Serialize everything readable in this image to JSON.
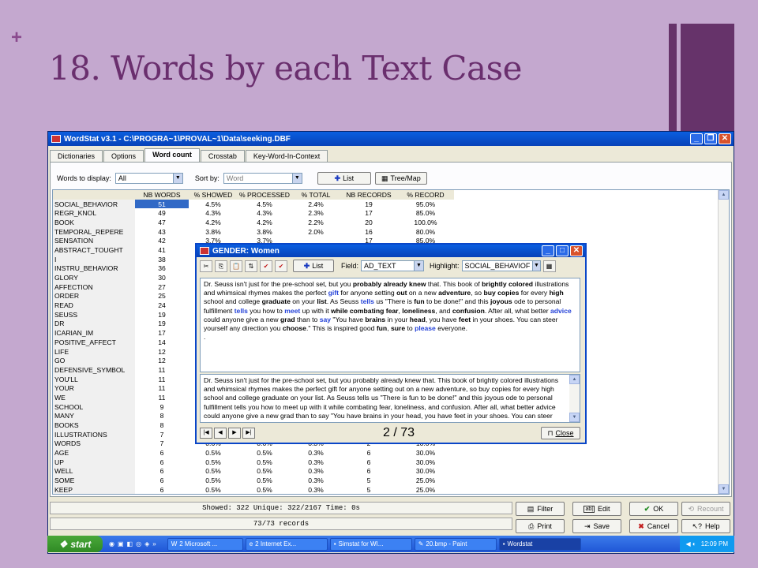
{
  "slide": {
    "plus": "+",
    "title": "18. Words by each Text Case"
  },
  "window": {
    "title": "WordStat v3.1 - C:\\PROGRA~1\\PROVAL~1\\Data\\seeking.DBF",
    "tabs": [
      "Dictionaries",
      "Options",
      "Word count",
      "Crosstab",
      "Key-Word-In-Context"
    ],
    "controls": {
      "words_label": "Words to display:",
      "words_value": "All",
      "sort_label": "Sort by:",
      "sort_value": "Word",
      "list_button": "List",
      "treemap_button": "Tree/Map"
    },
    "table": {
      "headers": [
        "",
        "NB WORDS",
        "% SHOWED",
        "% PROCESSED",
        "% TOTAL",
        "NB RECORDS",
        "% RECORD"
      ],
      "rows": [
        [
          "SOCIAL_BEHAVIOR",
          "51",
          "4.5%",
          "4.5%",
          "2.4%",
          "19",
          "95.0%"
        ],
        [
          "REGR_KNOL",
          "49",
          "4.3%",
          "4.3%",
          "2.3%",
          "17",
          "85.0%"
        ],
        [
          "BOOK",
          "47",
          "4.2%",
          "4.2%",
          "2.2%",
          "20",
          "100.0%"
        ],
        [
          "TEMPORAL_REPERE",
          "43",
          "3.8%",
          "3.8%",
          "2.0%",
          "16",
          "80.0%"
        ],
        [
          "SENSATION",
          "42",
          "3.7%",
          "3.7%",
          "",
          "17",
          "85.0%"
        ],
        [
          "ABSTRACT_TOUGHT",
          "41",
          "",
          "",
          "",
          "",
          ""
        ],
        [
          "I",
          "38",
          "",
          "",
          "",
          "",
          ""
        ],
        [
          "INSTRU_BEHAVIOR",
          "36",
          "",
          "",
          "",
          "",
          ""
        ],
        [
          "GLORY",
          "30",
          "",
          "",
          "",
          "",
          ""
        ],
        [
          "AFFECTION",
          "27",
          "",
          "",
          "",
          "",
          ""
        ],
        [
          "ORDER",
          "25",
          "",
          "",
          "",
          "",
          ""
        ],
        [
          "READ",
          "24",
          "",
          "",
          "",
          "",
          ""
        ],
        [
          "SEUSS",
          "19",
          "",
          "",
          "",
          "",
          ""
        ],
        [
          "DR",
          "19",
          "",
          "",
          "",
          "",
          ""
        ],
        [
          "ICARIAN_IM",
          "17",
          "",
          "",
          "",
          "",
          ""
        ],
        [
          "POSITIVE_AFFECT",
          "14",
          "",
          "",
          "",
          "",
          ""
        ],
        [
          "LIFE",
          "12",
          "",
          "",
          "",
          "",
          ""
        ],
        [
          "GO",
          "12",
          "",
          "",
          "",
          "",
          ""
        ],
        [
          "DEFENSIVE_SYMBOL",
          "11",
          "",
          "",
          "",
          "",
          ""
        ],
        [
          "YOU'LL",
          "11",
          "",
          "",
          "",
          "",
          ""
        ],
        [
          "YOUR",
          "11",
          "",
          "",
          "",
          "",
          ""
        ],
        [
          "WE",
          "11",
          "",
          "",
          "",
          "",
          ""
        ],
        [
          "SCHOOL",
          "9",
          "",
          "",
          "",
          "",
          ""
        ],
        [
          "MANY",
          "8",
          "",
          "",
          "",
          "",
          ""
        ],
        [
          "BOOKS",
          "8",
          "",
          "",
          "",
          "",
          ""
        ],
        [
          "ILLUSTRATIONS",
          "7",
          "",
          "",
          "",
          "",
          ""
        ],
        [
          "WORDS",
          "7",
          "0.6%",
          "0.6%",
          "0.3%",
          "2",
          "10.0%"
        ],
        [
          "AGE",
          "6",
          "0.5%",
          "0.5%",
          "0.3%",
          "6",
          "30.0%"
        ],
        [
          "UP",
          "6",
          "0.5%",
          "0.5%",
          "0.3%",
          "6",
          "30.0%"
        ],
        [
          "WELL",
          "6",
          "0.5%",
          "0.5%",
          "0.3%",
          "6",
          "30.0%"
        ],
        [
          "SOME",
          "6",
          "0.5%",
          "0.5%",
          "0.3%",
          "5",
          "25.0%"
        ],
        [
          "KEEP",
          "6",
          "0.5%",
          "0.5%",
          "0.3%",
          "5",
          "25.0%"
        ]
      ]
    },
    "status": {
      "line1": "Showed: 322  Unique: 322/2167  Time: 0s",
      "line2": "73/73 records"
    },
    "buttons": {
      "filter": "Filter",
      "edit": "Edit",
      "ok": "OK",
      "recount": "Recount",
      "print": "Print",
      "save": "Save",
      "cancel": "Cancel",
      "help": "Help"
    }
  },
  "dialog": {
    "title": "GENDER: Women",
    "list_button": "List",
    "field_label": "Field:",
    "field_value": "AD_TEXT",
    "highlight_label": "Highlight:",
    "highlight_value": "SOCIAL_BEHAVIOF",
    "plain_text": "Dr. Seuss isn't just for the pre-school set, but you probably already knew that. This book of brightly colored illustrations and whimsical rhymes makes the perfect gift for anyone setting out on a new adventure, so buy copies for every high school and college graduate on your list. As Seuss tells us \"There is fun to be done!\" and this joyous ode to personal fulfillment tells you how to meet up with it while combating fear, loneliness, and confusion. After all, what better advice could anyone give a new grad than to say \"You have brains in your head, you have feet in your shoes. You can steer yourself",
    "record": "2 / 73",
    "close": "Close"
  },
  "taskbar": {
    "start": "start",
    "tasks": [
      "2 Microsoft ...",
      "2 Internet Ex...",
      "Simstat for WI...",
      "20.bmp - Paint",
      "Wordstat"
    ],
    "clock": "12:09 PM"
  }
}
